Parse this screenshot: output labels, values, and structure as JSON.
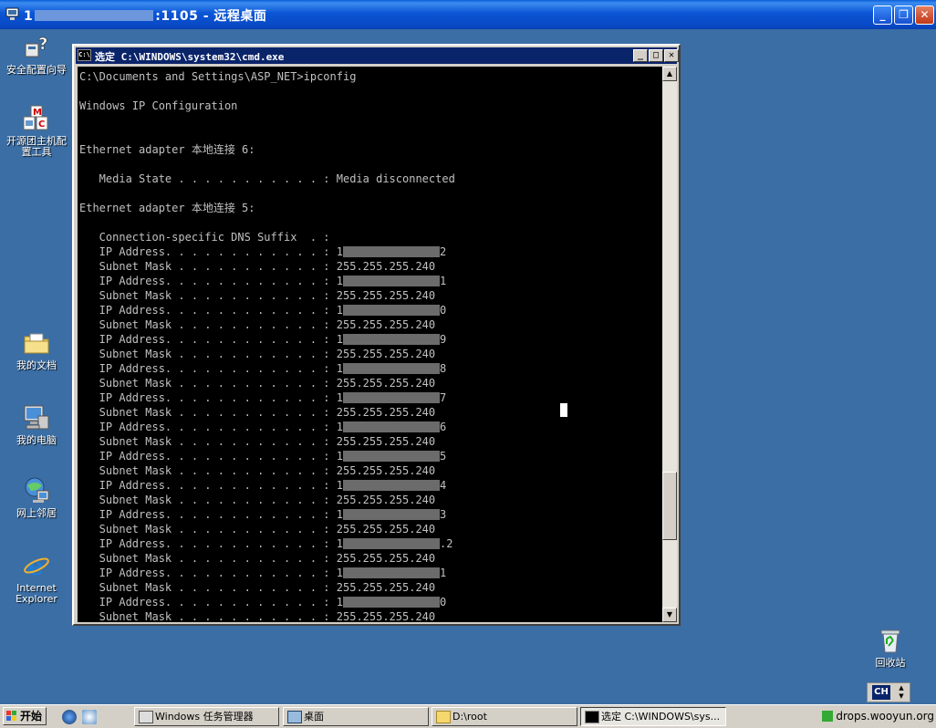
{
  "rdp": {
    "title_prefix": "1",
    "title_suffix": ":1105 - 远程桌面",
    "minimize": "_",
    "restore": "❐",
    "close": "✕"
  },
  "desktop_icons": [
    {
      "label": "安全配置向导"
    },
    {
      "label": "开源团主机配置工具"
    },
    {
      "label": "我的文档"
    },
    {
      "label": "我的电脑"
    },
    {
      "label": "网上邻居"
    },
    {
      "label": "Internet Explorer"
    },
    {
      "label": "回收站"
    }
  ],
  "cmd": {
    "title": "选定 C:\\WINDOWS\\system32\\cmd.exe",
    "icon": "C:\\",
    "lines": [
      "C:\\Documents and Settings\\ASP_NET>ipconfig",
      "",
      "Windows IP Configuration",
      "",
      "",
      "Ethernet adapter 本地连接 6:",
      "",
      "   Media State . . . . . . . . . . . : Media disconnected",
      "",
      "Ethernet adapter 本地连接 5:",
      "",
      "   Connection-specific DNS Suffix  . :"
    ],
    "ip_label": "   IP Address. . . . . . . . . . . . : ",
    "mask_label": "   Subnet Mask . . . . . . . . . . . : ",
    "subnet_mask": "255.255.255.240",
    "ip_entries": [
      {
        "first": "1",
        "last": "2"
      },
      {
        "first": "1",
        "last": "1"
      },
      {
        "first": "1",
        "last": "0"
      },
      {
        "first": "1",
        "last": "9"
      },
      {
        "first": "1",
        "last": "8"
      },
      {
        "first": "1",
        "last": "7"
      },
      {
        "first": "1",
        "last": "6"
      },
      {
        "first": "1",
        "last": "5"
      },
      {
        "first": "1",
        "last": "4"
      },
      {
        "first": "1",
        "last": "3"
      },
      {
        "first": "1",
        "last": ".2"
      },
      {
        "first": "1",
        "last": "1"
      },
      {
        "first": "1",
        "last": "0"
      }
    ]
  },
  "taskbar": {
    "start_label": "开始",
    "tasks": [
      {
        "label": "Windows 任务管理器"
      },
      {
        "label": "桌面"
      },
      {
        "label": "D:\\root"
      },
      {
        "label": "选定 C:\\WINDOWS\\sys..."
      }
    ],
    "language": "CH",
    "tray_text": "drops.wooyun.org"
  }
}
